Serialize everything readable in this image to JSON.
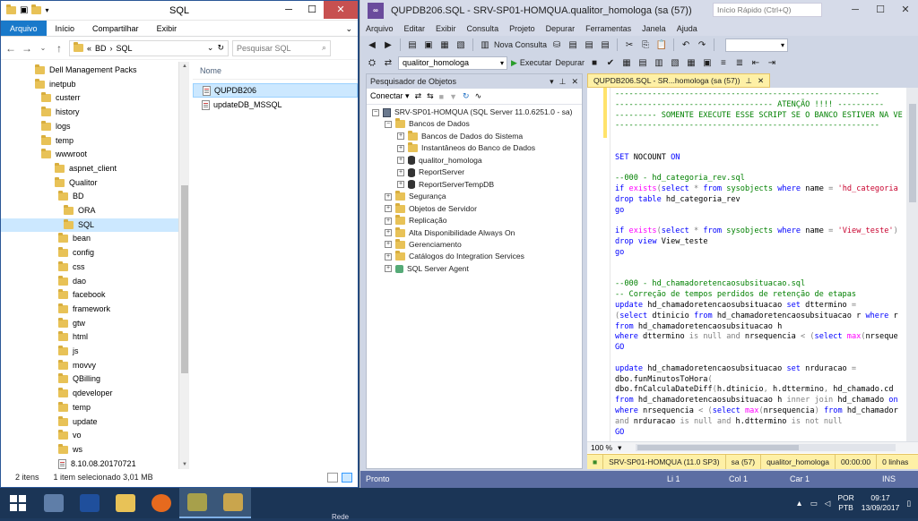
{
  "explorer": {
    "title": "SQL",
    "ribbon_tabs": [
      "Arquivo",
      "Início",
      "Compartilhar",
      "Exibir"
    ],
    "address": {
      "prefix": "«",
      "crumbs": [
        "BD",
        "SQL"
      ]
    },
    "search_placeholder": "Pesquisar SQL",
    "tree": [
      {
        "label": "Dell Management Packs",
        "level": 0
      },
      {
        "label": "inetpub",
        "level": 0
      },
      {
        "label": "custerr",
        "level": 1
      },
      {
        "label": "history",
        "level": 1
      },
      {
        "label": "logs",
        "level": 1
      },
      {
        "label": "temp",
        "level": 1
      },
      {
        "label": "wwwroot",
        "level": 1
      },
      {
        "label": "aspnet_client",
        "level": 2
      },
      {
        "label": "Qualitor",
        "level": 2
      },
      {
        "label": "BD",
        "level": 3
      },
      {
        "label": "ORA",
        "level": 4
      },
      {
        "label": "SQL",
        "level": 4,
        "selected": true
      },
      {
        "label": "bean",
        "level": 3
      },
      {
        "label": "config",
        "level": 3
      },
      {
        "label": "css",
        "level": 3
      },
      {
        "label": "dao",
        "level": 3
      },
      {
        "label": "facebook",
        "level": 3
      },
      {
        "label": "framework",
        "level": 3
      },
      {
        "label": "gtw",
        "level": 3
      },
      {
        "label": "html",
        "level": 3
      },
      {
        "label": "js",
        "level": 3
      },
      {
        "label": "movvy",
        "level": 3
      },
      {
        "label": "QBilling",
        "level": 3
      },
      {
        "label": "qdeveloper",
        "level": 3
      },
      {
        "label": "temp",
        "level": 3
      },
      {
        "label": "update",
        "level": 3
      },
      {
        "label": "vo",
        "level": 3
      },
      {
        "label": "ws",
        "level": 3
      },
      {
        "label": "8.10.08.20170721",
        "level": 3,
        "file": true
      }
    ],
    "files_header": "Nome",
    "files": [
      {
        "name": "QUPDB206",
        "selected": true
      },
      {
        "name": "updateDB_MSSQL",
        "selected": false
      }
    ],
    "status": {
      "count": "2 itens",
      "selection": "1 item selecionado  3,01 MB"
    }
  },
  "ssms": {
    "title": "QUPDB206.SQL - SRV-SP01-HOMQUA.qualitor_homologa (sa (57))",
    "quick_launch_placeholder": "Início Rápido (Ctrl+Q)",
    "menu": [
      "Arquivo",
      "Editar",
      "Exibir",
      "Consulta",
      "Projeto",
      "Depurar",
      "Ferramentas",
      "Janela",
      "Ajuda"
    ],
    "toolbar": {
      "new_query": "Nova Consulta",
      "database": "qualitor_homologa",
      "execute": "Executar",
      "debug": "Depurar"
    },
    "object_explorer": {
      "title": "Pesquisador de Objetos",
      "connect": "Conectar",
      "nodes": [
        {
          "label": "SRV-SP01-HOMQUA (SQL Server 11.0.6251.0 - sa)",
          "level": 0,
          "icon": "server",
          "exp": "-"
        },
        {
          "label": "Bancos de Dados",
          "level": 1,
          "icon": "folder",
          "exp": "-"
        },
        {
          "label": "Bancos de Dados do Sistema",
          "level": 2,
          "icon": "folder",
          "exp": "+"
        },
        {
          "label": "Instantâneos do Banco de Dados",
          "level": 2,
          "icon": "folder",
          "exp": "+"
        },
        {
          "label": "qualitor_homologa",
          "level": 2,
          "icon": "db",
          "exp": "+"
        },
        {
          "label": "ReportServer",
          "level": 2,
          "icon": "db",
          "exp": "+"
        },
        {
          "label": "ReportServerTempDB",
          "level": 2,
          "icon": "db",
          "exp": "+"
        },
        {
          "label": "Segurança",
          "level": 1,
          "icon": "folder",
          "exp": "+"
        },
        {
          "label": "Objetos de Servidor",
          "level": 1,
          "icon": "folder",
          "exp": "+"
        },
        {
          "label": "Replicação",
          "level": 1,
          "icon": "folder",
          "exp": "+"
        },
        {
          "label": "Alta Disponibilidade Always On",
          "level": 1,
          "icon": "folder",
          "exp": "+"
        },
        {
          "label": "Gerenciamento",
          "level": 1,
          "icon": "folder",
          "exp": "+"
        },
        {
          "label": "Catálogos do Integration Services",
          "level": 1,
          "icon": "folder",
          "exp": "+"
        },
        {
          "label": "SQL Server Agent",
          "level": 1,
          "icon": "agent",
          "exp": "+"
        }
      ]
    },
    "editor": {
      "tab_label": "QUPDB206.SQL - SR...homologa (sa (57))",
      "code_lines": [
        [
          [
            "gr",
            "---------------------------------------------------------"
          ]
        ],
        [
          [
            "gr",
            "---------------------------------- ATENÇÃO !!!! ----------"
          ]
        ],
        [
          [
            "gr",
            "--------- SOMENTE EXECUTE ESSE SCRIPT SE O BANCO ESTIVER NA VE"
          ]
        ],
        [
          [
            "gr",
            "---------------------------------------------------------"
          ]
        ],
        [],
        [],
        [
          [
            "kw",
            "SET"
          ],
          [
            "bk",
            " NOCOUNT "
          ],
          [
            "kw",
            "ON"
          ]
        ],
        [],
        [
          [
            "gr",
            "--000 - hd_categoria_rev.sql"
          ]
        ],
        [
          [
            "kw",
            "if"
          ],
          [
            "bk",
            " "
          ],
          [
            "fn",
            "exists"
          ],
          [
            "gy",
            "("
          ],
          [
            "kw",
            "select"
          ],
          [
            "bk",
            " "
          ],
          [
            "gy",
            "*"
          ],
          [
            "bk",
            " "
          ],
          [
            "kw",
            "from"
          ],
          [
            "bk",
            " "
          ],
          [
            "gr",
            "sysobjects"
          ],
          [
            "bk",
            " "
          ],
          [
            "kw",
            "where"
          ],
          [
            "bk",
            " name "
          ],
          [
            "gy",
            "="
          ],
          [
            "bk",
            " "
          ],
          [
            "rd",
            "'hd_categoria"
          ]
        ],
        [
          [
            "kw",
            "drop table"
          ],
          [
            "bk",
            " hd_categoria_rev"
          ]
        ],
        [
          [
            "kw",
            "go"
          ]
        ],
        [],
        [
          [
            "kw",
            "if"
          ],
          [
            "bk",
            " "
          ],
          [
            "fn",
            "exists"
          ],
          [
            "gy",
            "("
          ],
          [
            "kw",
            "select"
          ],
          [
            "bk",
            " "
          ],
          [
            "gy",
            "*"
          ],
          [
            "bk",
            " "
          ],
          [
            "kw",
            "from"
          ],
          [
            "bk",
            " "
          ],
          [
            "gr",
            "sysobjects"
          ],
          [
            "bk",
            " "
          ],
          [
            "kw",
            "where"
          ],
          [
            "bk",
            " name "
          ],
          [
            "gy",
            "="
          ],
          [
            "bk",
            " "
          ],
          [
            "rd",
            "'View_teste'"
          ],
          [
            "gy",
            ")"
          ]
        ],
        [
          [
            "kw",
            "drop view"
          ],
          [
            "bk",
            " View_teste"
          ]
        ],
        [
          [
            "kw",
            "go"
          ]
        ],
        [],
        [],
        [
          [
            "gr",
            "--000 - hd_chamadoretencaosubsituacao.sql"
          ]
        ],
        [
          [
            "gr",
            "-- Correção de tempos perdidos de retenção de etapas"
          ]
        ],
        [
          [
            "kw",
            "update"
          ],
          [
            "bk",
            " hd_chamadoretencaosubsituacao "
          ],
          [
            "kw",
            "set"
          ],
          [
            "bk",
            " dttermino "
          ],
          [
            "gy",
            "="
          ]
        ],
        [
          [
            "gy",
            "("
          ],
          [
            "kw",
            "select"
          ],
          [
            "bk",
            " dtinicio "
          ],
          [
            "kw",
            "from"
          ],
          [
            "bk",
            " hd_chamadoretencaosubsituacao r "
          ],
          [
            "kw",
            "where"
          ],
          [
            "bk",
            " r"
          ]
        ],
        [
          [
            "kw",
            "from"
          ],
          [
            "bk",
            " hd_chamadoretencaosubsituacao h"
          ]
        ],
        [
          [
            "kw",
            "where"
          ],
          [
            "bk",
            " dttermino "
          ],
          [
            "gy",
            "is null and"
          ],
          [
            "bk",
            " nrsequencia "
          ],
          [
            "gy",
            "<"
          ],
          [
            "bk",
            " "
          ],
          [
            "gy",
            "("
          ],
          [
            "kw",
            "select"
          ],
          [
            "bk",
            " "
          ],
          [
            "fn",
            "max"
          ],
          [
            "gy",
            "("
          ],
          [
            "bk",
            "nrseque"
          ]
        ],
        [
          [
            "kw",
            "GO"
          ]
        ],
        [],
        [
          [
            "kw",
            "update"
          ],
          [
            "bk",
            " hd_chamadoretencaosubsituacao "
          ],
          [
            "kw",
            "set"
          ],
          [
            "bk",
            " nrduracao "
          ],
          [
            "gy",
            "="
          ]
        ],
        [
          [
            "bk",
            "dbo.funMinutosToHora"
          ],
          [
            "gy",
            "("
          ]
        ],
        [
          [
            "bk",
            "dbo.fnCalculaDateDiff"
          ],
          [
            "gy",
            "("
          ],
          [
            "bk",
            "h.dtinicio"
          ],
          [
            "gy",
            ","
          ],
          [
            "bk",
            " h.dttermino"
          ],
          [
            "gy",
            ","
          ],
          [
            "bk",
            " hd_chamado.cd"
          ]
        ],
        [
          [
            "kw",
            "from"
          ],
          [
            "bk",
            " hd_chamadoretencaosubsituacao h "
          ],
          [
            "gy",
            "inner join"
          ],
          [
            "bk",
            " hd_chamado "
          ],
          [
            "kw",
            "on"
          ]
        ],
        [
          [
            "kw",
            "where"
          ],
          [
            "bk",
            " nrsequencia "
          ],
          [
            "gy",
            "<"
          ],
          [
            "bk",
            " "
          ],
          [
            "gy",
            "("
          ],
          [
            "kw",
            "select"
          ],
          [
            "bk",
            " "
          ],
          [
            "fn",
            "max"
          ],
          [
            "gy",
            "("
          ],
          [
            "bk",
            "nrsequencia"
          ],
          [
            "gy",
            ")"
          ],
          [
            "bk",
            " "
          ],
          [
            "kw",
            "from"
          ],
          [
            "bk",
            " hd_chamador"
          ]
        ],
        [
          [
            "gy",
            "and"
          ],
          [
            "bk",
            " nrduracao "
          ],
          [
            "gy",
            "is null and"
          ],
          [
            "bk",
            " h.dttermino "
          ],
          [
            "gy",
            "is not null"
          ]
        ],
        [
          [
            "kw",
            "GO"
          ]
        ]
      ],
      "zoom": "100 %",
      "query_status": [
        "SRV-SP01-HOMQUA (11.0 SP3)",
        "sa (57)",
        "qualitor_homologa",
        "00:00:00",
        "0 linhas"
      ]
    },
    "statusbar": {
      "ready": "Pronto",
      "line": "Li 1",
      "col": "Col 1",
      "char": "Car 1",
      "ins": "INS"
    }
  },
  "taskbar": {
    "lang": "POR",
    "layout": "PTB",
    "time": "09:17",
    "date": "13/09/2017",
    "network_tip": "Rede"
  },
  "colors": {
    "accent": "#1979ca",
    "ssms_status": "#5c6ea3",
    "tab_active": "#fef0a6"
  }
}
